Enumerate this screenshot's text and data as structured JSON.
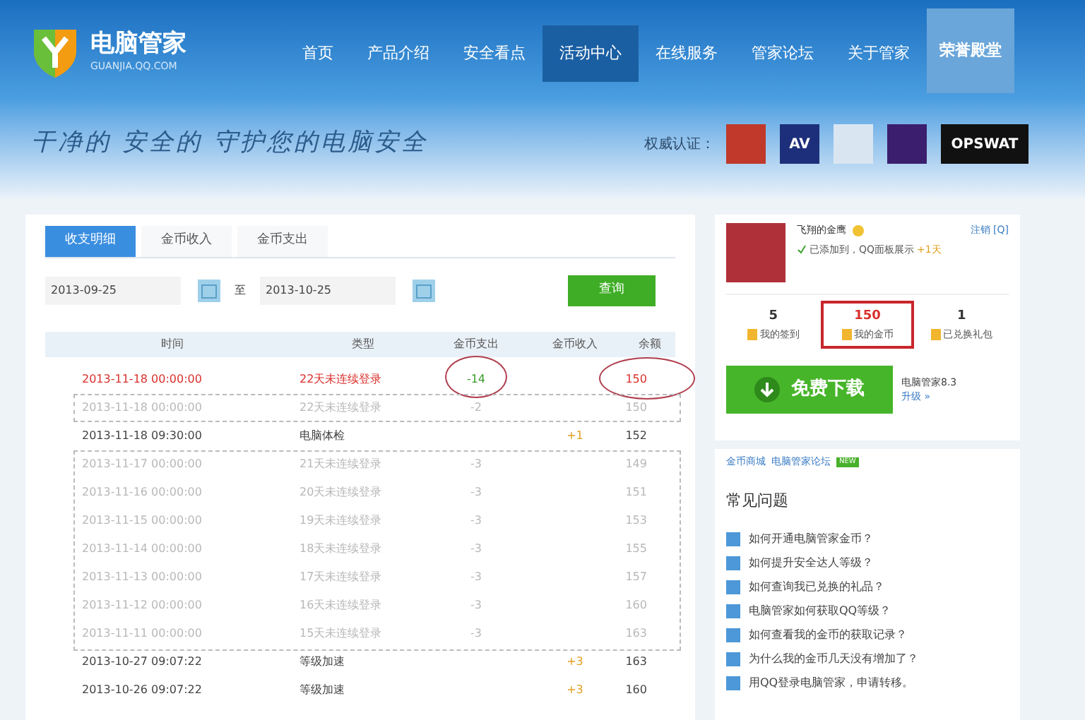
{
  "brand": {
    "name": "电脑管家",
    "domain": "GUANJIA.QQ.COM"
  },
  "nav": [
    {
      "label": "首页",
      "selected": false
    },
    {
      "label": "产品介绍",
      "selected": false
    },
    {
      "label": "安全看点",
      "selected": false
    },
    {
      "label": "活动中心",
      "selected": true
    },
    {
      "label": "在线服务",
      "selected": false
    },
    {
      "label": "管家论坛",
      "selected": false
    },
    {
      "label": "关于管家",
      "selected": false
    }
  ],
  "nav_button": "荣誉殿堂",
  "slogan": "干净的 安全的 守护您的电脑安全",
  "certification": {
    "label": "权威认证：",
    "badges": [
      {
        "color": "#c0392b"
      },
      {
        "label": "AV",
        "color": "#1d2f7a"
      },
      {
        "color": "#d9e6f2"
      },
      {
        "color": "#3b1f6e"
      },
      {
        "label": "OPSWAT",
        "color": "#111111"
      }
    ]
  },
  "tabs": [
    {
      "label": "收支明细",
      "selected": true
    },
    {
      "label": "金币收入",
      "selected": false
    },
    {
      "label": "金币支出",
      "selected": false
    }
  ],
  "date_from": "2013-09-25",
  "date_sep": "至",
  "date_to": "2013-10-25",
  "query_button": "查询",
  "table": {
    "columns": [
      "时间",
      "类型",
      "金币支出",
      "金币收入",
      "余额"
    ],
    "rows": [
      {
        "time": "2013-11-18 00:00:00",
        "type": "22天未连续登录",
        "spend": "-14",
        "balance": "150",
        "kind": "alert"
      },
      {
        "time": "2013-11-18 00:00:00",
        "type": "22天未连续登录",
        "spend": "-2",
        "balance": "150",
        "kind": "dimmed"
      },
      {
        "time": "2013-11-18 09:30:00",
        "type": "电脑体检",
        "income": "+1",
        "balance": "152",
        "kind": "normal"
      },
      {
        "time": "2013-11-17 00:00:00",
        "type": "21天未连续登录",
        "spend": "-3",
        "balance": "149",
        "kind": "dimmed"
      },
      {
        "time": "2013-11-16 00:00:00",
        "type": "20天未连续登录",
        "spend": "-3",
        "balance": "151",
        "kind": "dimmed"
      },
      {
        "time": "2013-11-15 00:00:00",
        "type": "19天未连续登录",
        "spend": "-3",
        "balance": "153",
        "kind": "dimmed"
      },
      {
        "time": "2013-11-14 00:00:00",
        "type": "18天未连续登录",
        "spend": "-3",
        "balance": "155",
        "kind": "dimmed"
      },
      {
        "time": "2013-11-13 00:00:00",
        "type": "17天未连续登录",
        "spend": "-3",
        "balance": "157",
        "kind": "dimmed"
      },
      {
        "time": "2013-11-12 00:00:00",
        "type": "16天未连续登录",
        "spend": "-3",
        "balance": "160",
        "kind": "dimmed"
      },
      {
        "time": "2013-11-11 00:00:00",
        "type": "15天未连续登录",
        "spend": "-3",
        "balance": "163",
        "kind": "dimmed"
      },
      {
        "time": "2013-10-27 09:07:22",
        "type": "等级加速",
        "income": "+3",
        "balance": "163",
        "kind": "normal"
      },
      {
        "time": "2013-10-26 09:07:22",
        "type": "等级加速",
        "income": "+3",
        "balance": "160",
        "kind": "normal"
      }
    ]
  },
  "profile": {
    "name": "飞翔的金鹰",
    "logout": "注销 [Q]",
    "status": "已添加到，QQ面板展示",
    "bonus": "+1天"
  },
  "stats": [
    {
      "value": "5",
      "label": "我的签到",
      "selected": false
    },
    {
      "value": "150",
      "label": "我的金币",
      "selected": true
    },
    {
      "value": "1",
      "label": "已兑换礼包",
      "selected": false
    }
  ],
  "download": {
    "button": "免费下载",
    "version": "电脑管家8.3",
    "upgrade": "升级 »"
  },
  "links": [
    "金币商城",
    "电脑管家论坛"
  ],
  "new_badge": "NEW",
  "faq": {
    "title": "常见问题",
    "items": [
      "如何开通电脑管家金币？",
      "如何提升安全达人等级？",
      "如何查询我已兑换的礼品？",
      "电脑管家如何获取QQ等级？",
      "如何查看我的金币的获取记录？",
      "为什么我的金币几天没有增加了？",
      "用QQ登录电脑管家，申请转移。"
    ]
  }
}
